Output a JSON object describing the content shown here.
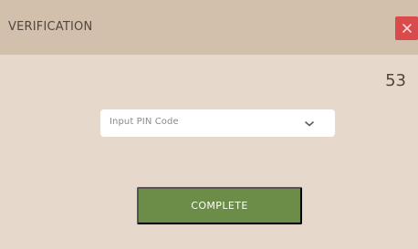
{
  "dialog": {
    "title": "VERIFICATION",
    "close_icon": "close-icon",
    "countdown": "53"
  },
  "pin_input": {
    "placeholder": "Input PIN Code",
    "icon": "chevron-down-icon"
  },
  "buttons": {
    "complete_label": "COMPLETE"
  },
  "colors": {
    "background": "#e6d9cb",
    "header": "#d2c0ac",
    "close": "#d94a4a",
    "complete": "#6b8d48",
    "text": "#4f473e"
  }
}
